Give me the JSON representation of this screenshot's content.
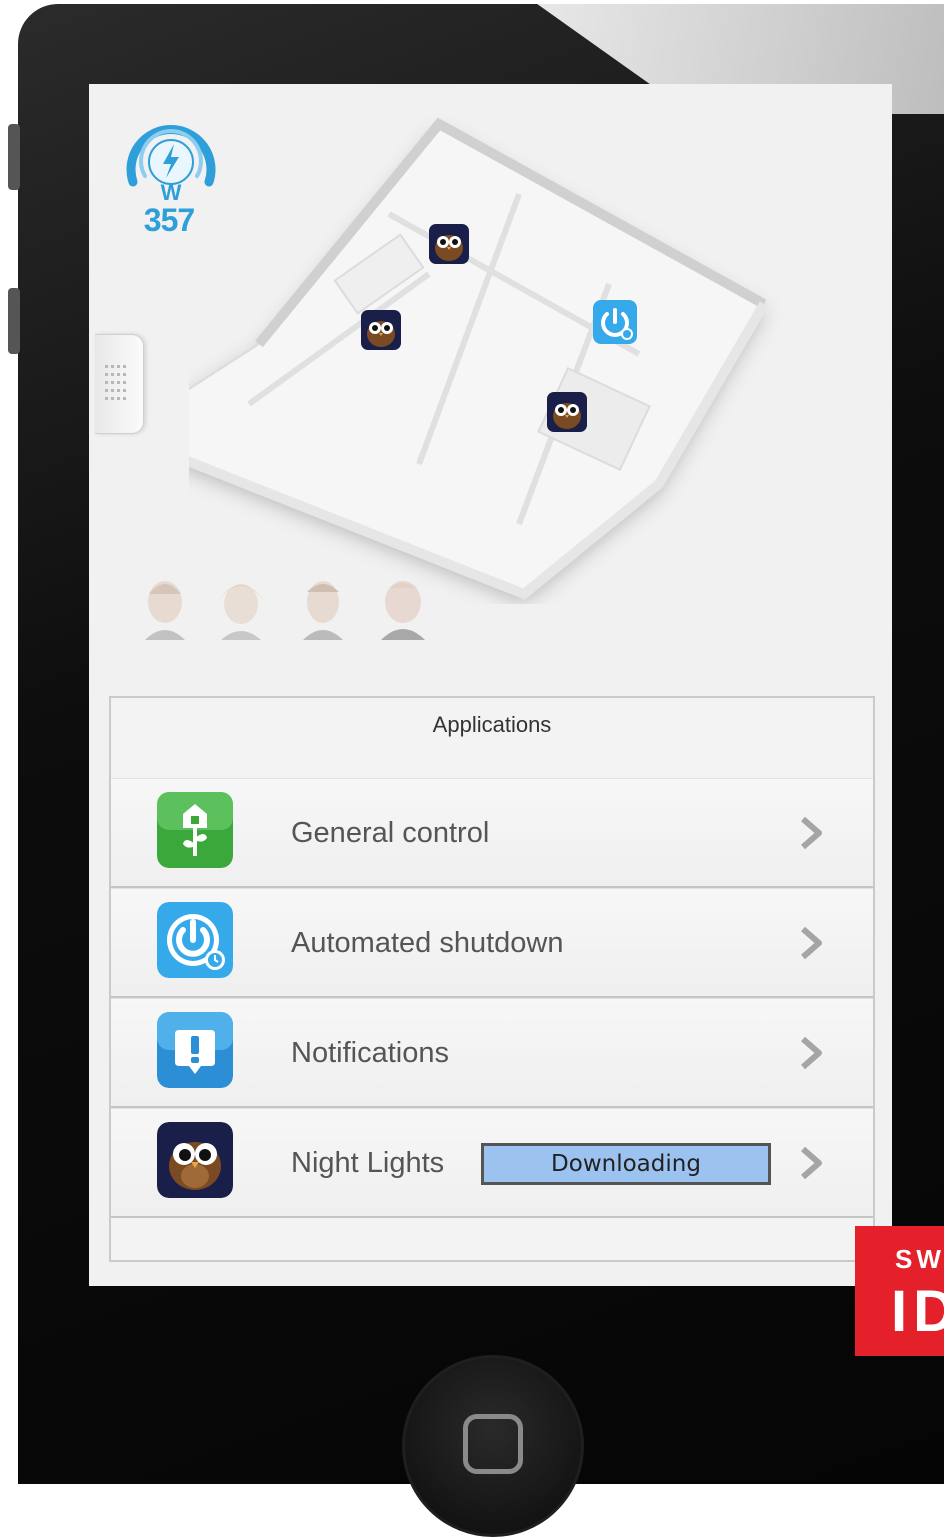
{
  "power_meter": {
    "value": "357",
    "unit": "W",
    "icon": "lightning-icon"
  },
  "map_markers": [
    {
      "name": "night-lights-marker",
      "icon": "owl-icon"
    },
    {
      "name": "night-lights-marker",
      "icon": "owl-icon"
    },
    {
      "name": "automated-shutdown-marker",
      "icon": "power-timer-icon"
    },
    {
      "name": "night-lights-marker",
      "icon": "owl-icon"
    }
  ],
  "applications": {
    "title": "Applications",
    "items": [
      {
        "label": "General control",
        "icon": "house-flower-icon",
        "color": "#3aa83a"
      },
      {
        "label": "Automated shutdown",
        "icon": "power-timer-icon",
        "color": "#35a9ea"
      },
      {
        "label": "Notifications",
        "icon": "exclamation-bubble-icon",
        "color": "#2c8fd6"
      },
      {
        "label": "Night Lights",
        "icon": "owl-icon",
        "color": "#1a1f4a",
        "status": "Downloading"
      }
    ]
  },
  "logo": {
    "line1": "SW",
    "line2": "ID"
  },
  "colors": {
    "accent": "#2e9fd9",
    "download_bar": "#9cc3f0",
    "logo_red": "#e4202b"
  }
}
